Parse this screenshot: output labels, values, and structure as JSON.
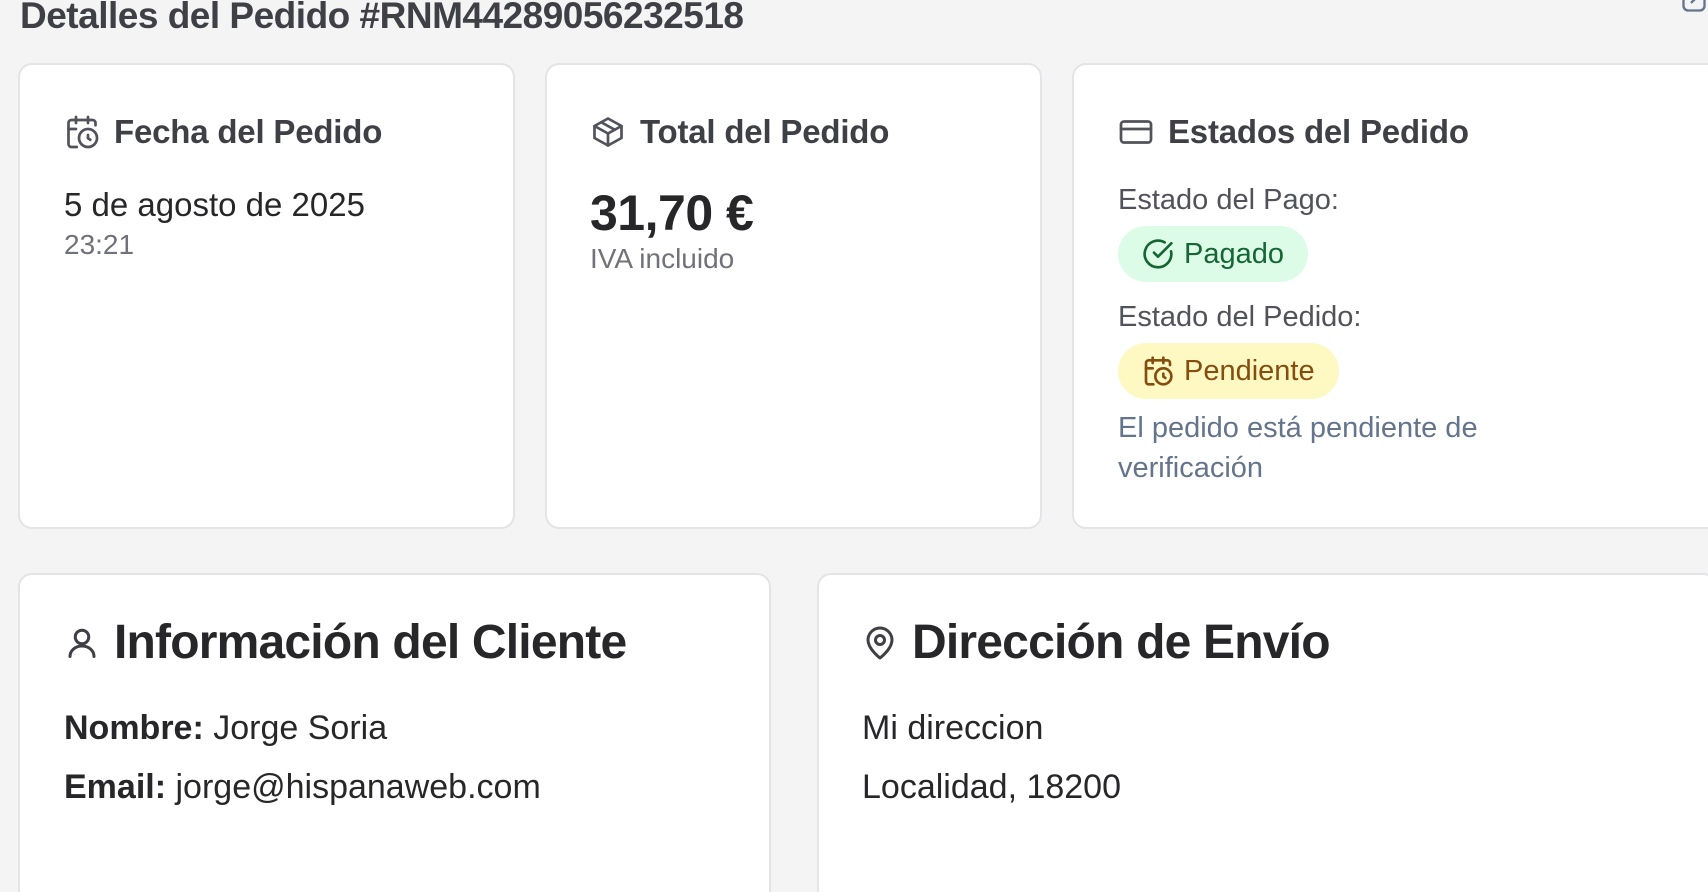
{
  "page": {
    "title": "Detalles del Pedido #RNM44289056232518"
  },
  "icons": {
    "corner": "external-link-icon",
    "date": "calendar-clock-icon",
    "total": "package-icon",
    "status": "credit-card-icon",
    "paid": "check-circle-icon",
    "pending": "calendar-clock-icon",
    "customer": "user-icon",
    "shipping": "map-pin-icon"
  },
  "colors": {
    "paid_bg": "#dcfce7",
    "paid_text": "#166534",
    "pending_bg": "#fef9c3",
    "pending_text": "#854d0e"
  },
  "date_card": {
    "title": "Fecha del Pedido",
    "date": "5 de agosto de 2025",
    "time": "23:21"
  },
  "total_card": {
    "title": "Total del Pedido",
    "amount": "31,70 €",
    "tax_note": "IVA incluido"
  },
  "status_card": {
    "title": "Estados del Pedido",
    "payment_label": "Estado del Pago:",
    "payment_status": "Pagado",
    "order_label": "Estado del Pedido:",
    "order_status": "Pendiente",
    "note": "El pedido está pendiente de verificación"
  },
  "customer_card": {
    "title": "Información del Cliente",
    "name_label": "Nombre:",
    "name_value": "Jorge Soria",
    "email_label": "Email:",
    "email_value": "jorge@hispanaweb.com"
  },
  "shipping_card": {
    "title": "Dirección de Envío",
    "address": "Mi direccion",
    "locality": "Localidad, 18200"
  }
}
